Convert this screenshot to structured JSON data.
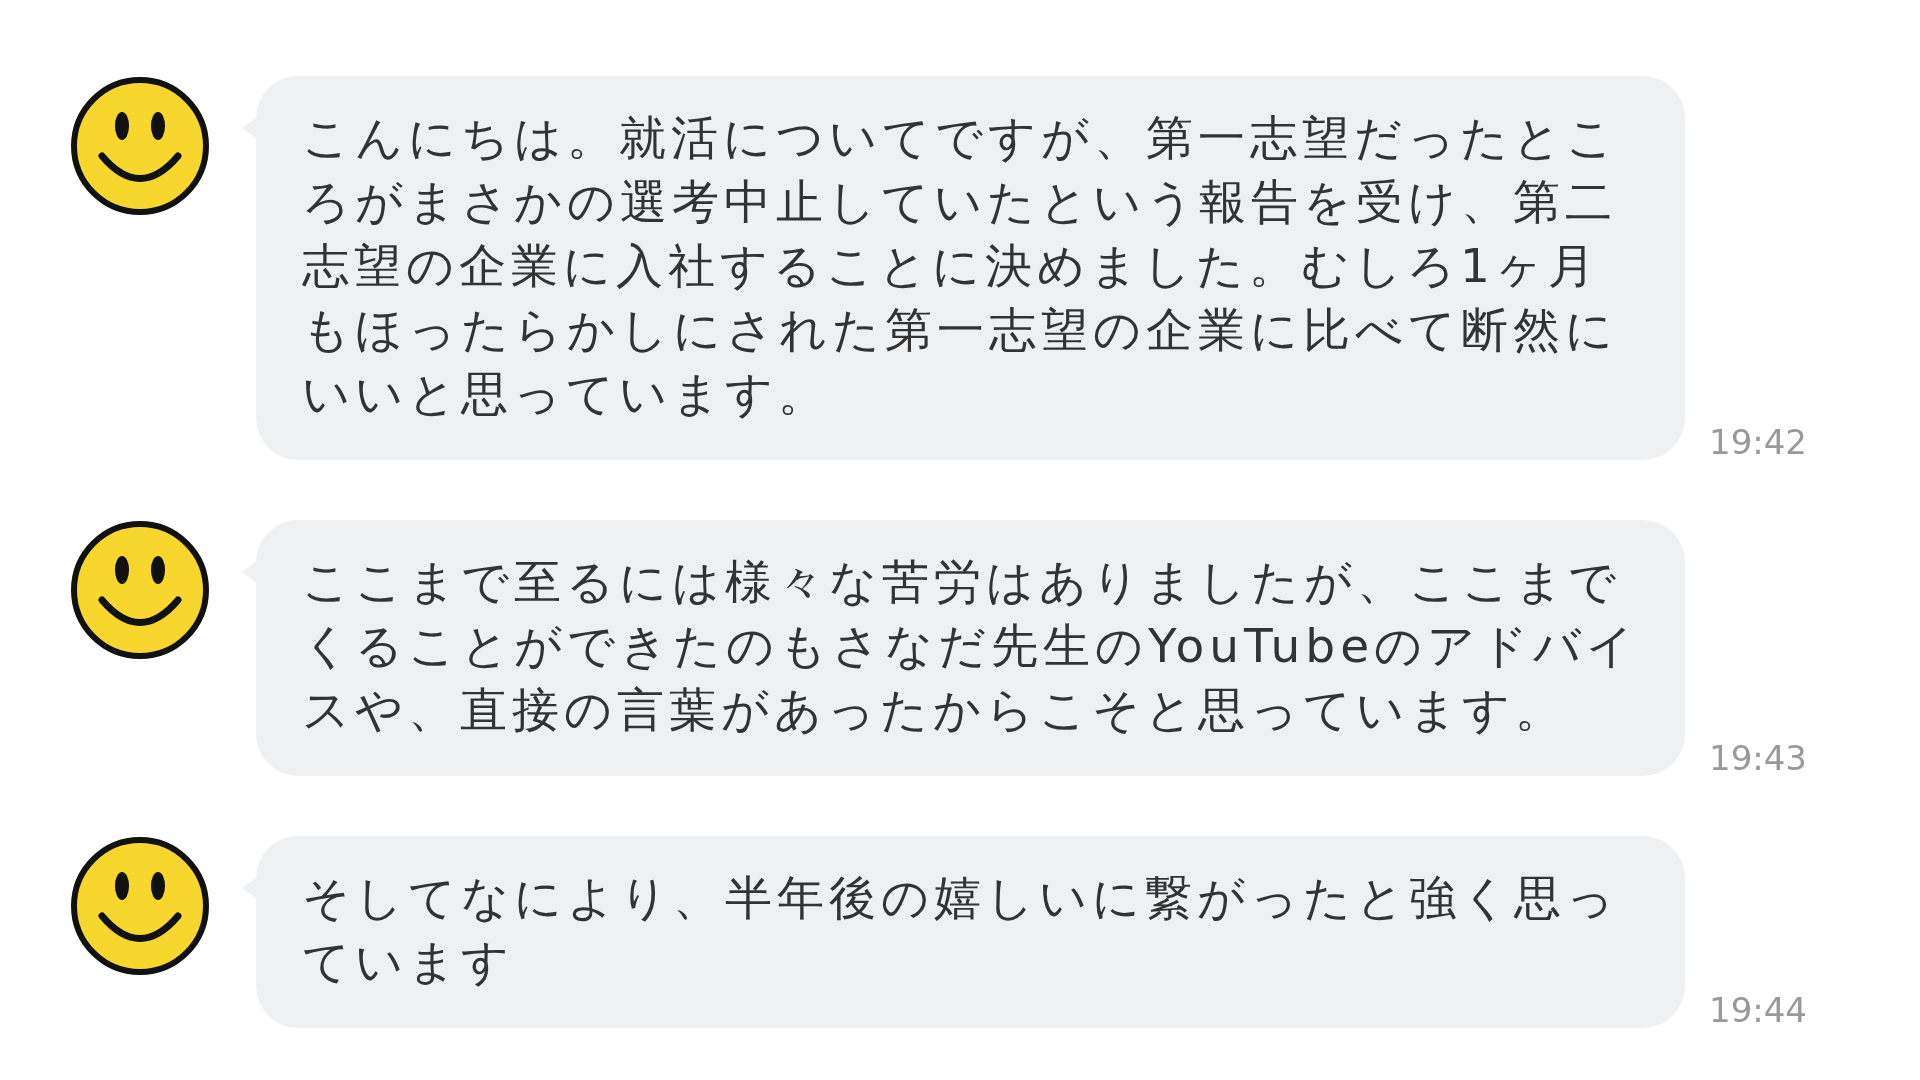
{
  "messages": [
    {
      "text": "こんにちは。就活についてですが、第一志望だったところがまさかの選考中止していたという報告を受け、第二志望の企業に入社することに決めました。むしろ1ヶ月もほったらかしにされた第一志望の企業に比べて断然にいいと思っています。",
      "time": "19:42"
    },
    {
      "text": "ここまで至るには様々な苦労はありましたが、ここまでくることができたのもさなだ先生のYouTubeのアドバイスや、直接の言葉があったからこそと思っています。",
      "time": "19:43"
    },
    {
      "text": "そしてなにより、半年後の嬉しいに繋がったと強く思っています",
      "time": "19:44"
    }
  ]
}
